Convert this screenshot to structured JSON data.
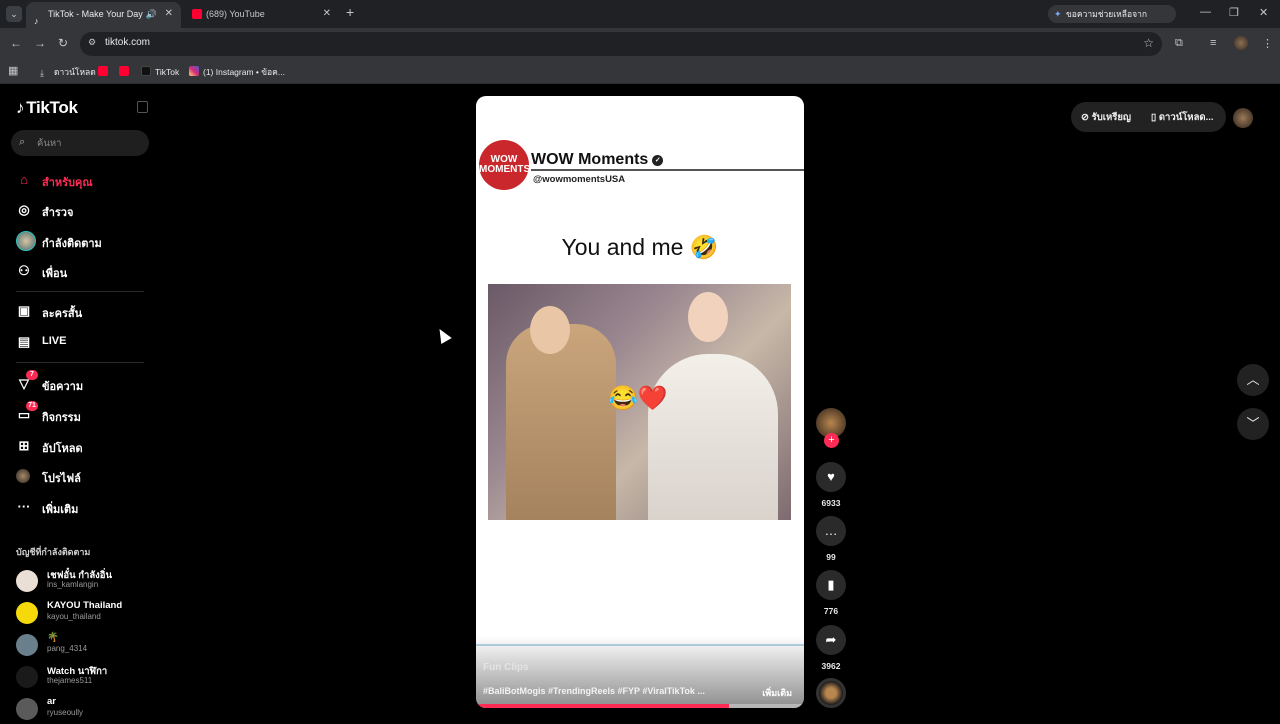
{
  "browser": {
    "tabs": [
      {
        "title": "TikTok - Make Your Day",
        "active": true
      },
      {
        "title": "(689) YouTube",
        "active": false
      }
    ],
    "gemini_label": "ขอความช่วยเหลือจาก Gemini",
    "url": "tiktok.com",
    "bookmarks": [
      {
        "label": "ดาวน์โหลด",
        "icon": "download-icon"
      },
      {
        "label": "",
        "icon": "youtube-icon"
      },
      {
        "label": "",
        "icon": "youtube-icon"
      },
      {
        "label": "TikTok",
        "icon": "tiktok-icon"
      },
      {
        "label": "(1) Instagram • ข้อค...",
        "icon": "instagram-icon"
      }
    ]
  },
  "tiktok": {
    "logo": "TikTok",
    "search_placeholder": "ค้นหา",
    "nav": [
      {
        "label": "สำหรับคุณ",
        "icon": "home-icon",
        "active": true
      },
      {
        "label": "สำรวจ",
        "icon": "compass-icon"
      },
      {
        "label": "กำลังติดตาม",
        "icon": "following-avatar"
      },
      {
        "label": "เพื่อน",
        "icon": "friends-icon"
      },
      {
        "label": "ละครสั้น",
        "icon": "drama-icon"
      },
      {
        "label": "LIVE",
        "icon": "live-icon"
      },
      {
        "label": "ข้อความ",
        "icon": "message-icon",
        "badge": "7"
      },
      {
        "label": "กิจกรรม",
        "icon": "activity-icon",
        "badge": "71"
      },
      {
        "label": "อัปโหลด",
        "icon": "upload-icon"
      },
      {
        "label": "โปรไฟล์",
        "icon": "profile-avatar"
      },
      {
        "label": "เพิ่มเติม",
        "icon": "more-icon"
      }
    ],
    "following_title": "บัญชีที่กำลังติดตาม",
    "following": [
      {
        "name": "เชฟอั๋น กำลังอิ่น",
        "handle": "ins_kamlangin",
        "color": "#e9dfd6"
      },
      {
        "name": "KAYOU Thailand",
        "handle": "kayou_thailand",
        "color": "#f5d90a"
      },
      {
        "name": "🌴",
        "handle": "pang_4314",
        "color": "#6a7f8c"
      },
      {
        "name": "Watch นาฬิกา",
        "handle": "thejames511",
        "color": "#1a1a1a"
      },
      {
        "name": "ar",
        "handle": "ryuseoully",
        "color": "#5a5a5a"
      }
    ],
    "top_right": {
      "coins": "รับเหรียญ",
      "download_app": "ดาวน์โหลด..."
    }
  },
  "video": {
    "account_logo": "WOW MOMENTS",
    "account_name": "WOW Moments",
    "account_handle": "@wowmomentsUSA",
    "caption": "You and me 🤣",
    "overlay_emoji": "😂❤️",
    "music": "Fun Clips",
    "hashtags": "#BaliBotMogis #TrendingReels #FYP #ViralTikTok ...",
    "more_label": "เพิ่มเติม",
    "progress": 0.77,
    "likes": "6933",
    "comments": "99",
    "saves": "776",
    "shares": "3962"
  },
  "colors": {
    "brand": "#fe2c55",
    "background": "#000000"
  }
}
